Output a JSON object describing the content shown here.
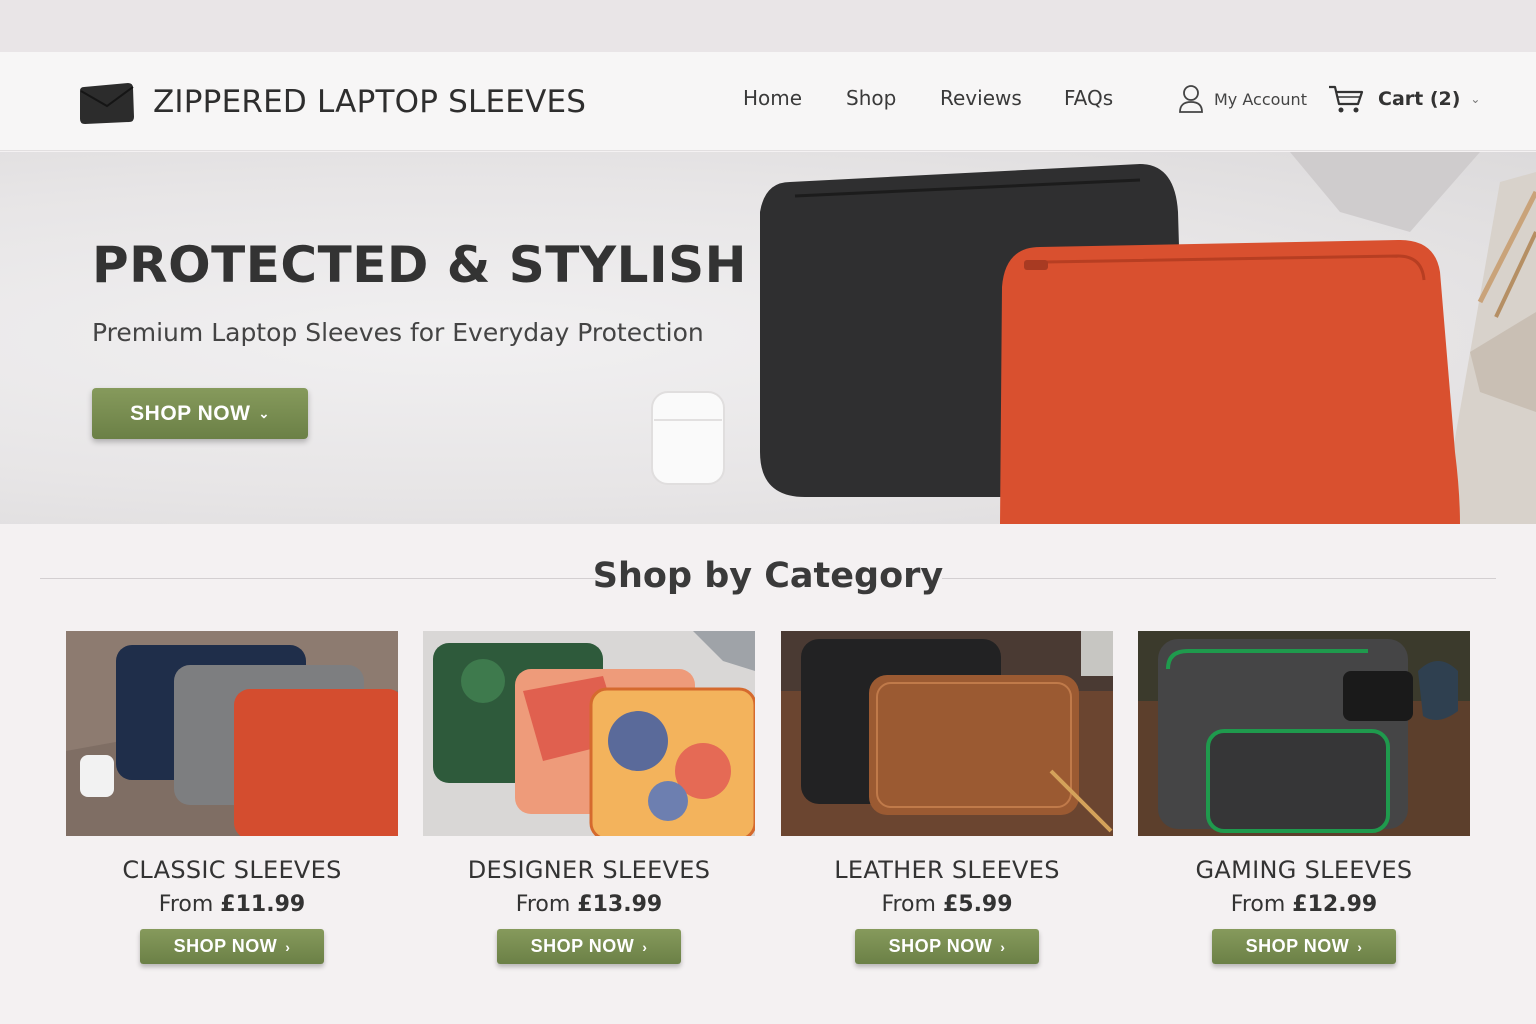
{
  "brand": {
    "name": "ZIPPERED LAPTOP SLEEVES",
    "logo_icon": "envelope-sleeve-logo"
  },
  "nav": {
    "links": [
      "Home",
      "Shop",
      "Reviews",
      "FAQs"
    ],
    "account_label": "My Account",
    "account_icon": "user-icon",
    "cart_label": "Cart (2)",
    "cart_icon": "cart-icon"
  },
  "hero": {
    "title": "PROTECTED & STYLISH",
    "subtitle": "Premium Laptop Sleeves for Everyday Protection",
    "button_label": "SHOP NOW",
    "button_icon": "chevron-down-icon"
  },
  "categories": {
    "title": "Shop by Category",
    "items": [
      {
        "name": "CLASSIC SLEEVES",
        "price_prefix": "From",
        "price": "£11.99",
        "button_label": "SHOP NOW"
      },
      {
        "name": "DESIGNER SLEEVES",
        "price_prefix": "From",
        "price": "£13.99",
        "button_label": "SHOP NOW"
      },
      {
        "name": "LEATHER SLEEVES",
        "price_prefix": "From",
        "price": "£5.99",
        "button_label": "SHOP NOW"
      },
      {
        "name": "GAMING SLEEVES",
        "price_prefix": "From",
        "price": "£12.99",
        "button_label": "SHOP NOW"
      }
    ]
  },
  "colors": {
    "accent_green": "#7a8f52",
    "sleeve_red": "#d9502f",
    "sleeve_black": "#2f2f30"
  }
}
